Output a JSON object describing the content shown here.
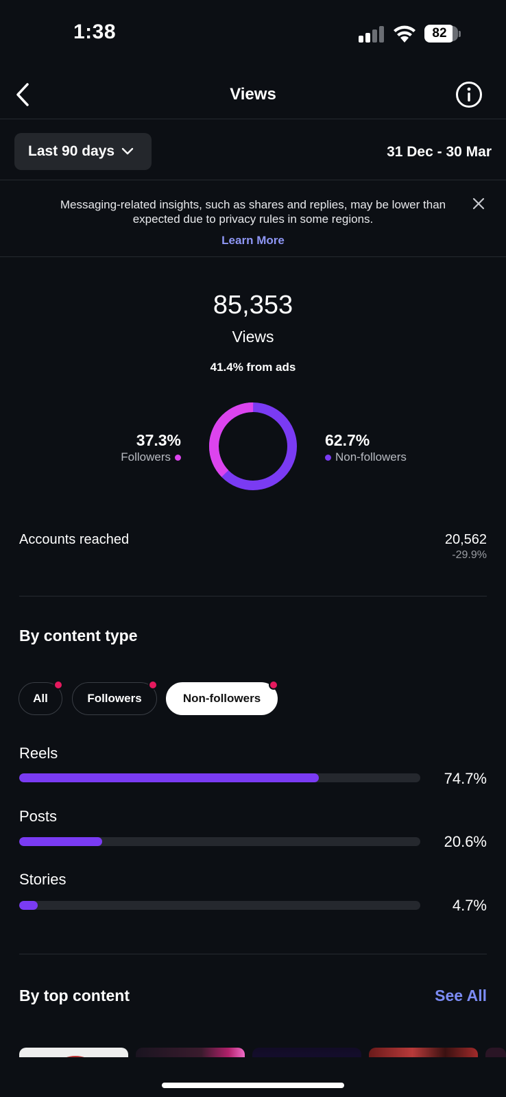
{
  "status_bar": {
    "time": "1:38",
    "battery": "82"
  },
  "header": {
    "title": "Views"
  },
  "range": {
    "label": "Last 90 days",
    "dates": "31 Dec - 30 Mar"
  },
  "notice": {
    "text": "Messaging-related insights, such as shares and replies, may be lower than expected due to privacy rules in some regions.",
    "link": "Learn More"
  },
  "summary": {
    "total": "85,353",
    "label": "Views",
    "ads": "41.4% from ads",
    "followers_pct": "37.3%",
    "followers_label": "Followers",
    "nonfollowers_pct": "62.7%",
    "nonfollowers_label": "Non-followers",
    "followers_fraction": 0.373
  },
  "accounts_reached": {
    "label": "Accounts reached",
    "value": "20,562",
    "change": "-29.9%"
  },
  "content_type": {
    "title": "By content type",
    "chips": [
      "All",
      "Followers",
      "Non-followers"
    ],
    "active_chip": "Non-followers",
    "bars": [
      {
        "label": "Reels",
        "pct": "74.7%",
        "value": 74.7
      },
      {
        "label": "Posts",
        "pct": "20.6%",
        "value": 20.6
      },
      {
        "label": "Stories",
        "pct": "4.7%",
        "value": 4.7
      }
    ]
  },
  "top_content": {
    "title": "By top content",
    "see_all": "See All"
  },
  "colors": {
    "followers": "#dc44ee",
    "nonfollowers": "#7a3bf3",
    "link": "#8e96f4",
    "badge": "#e5195e"
  }
}
